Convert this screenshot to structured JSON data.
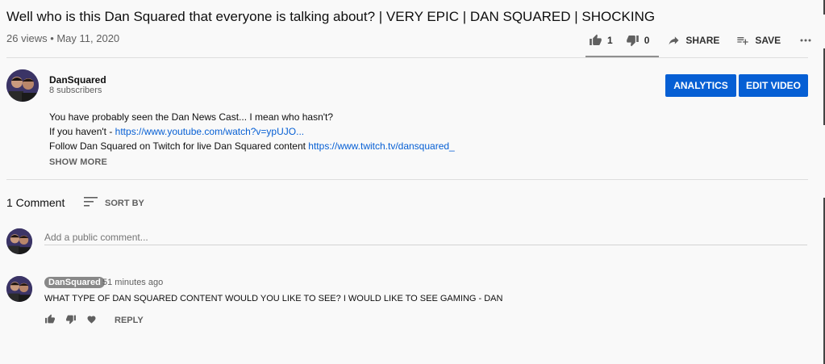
{
  "video": {
    "title": "Well who is this Dan Squared that everyone is talking about? | VERY EPIC | DAN SQUARED | SHOCKING",
    "meta": "26 views • May 11, 2020"
  },
  "actions": {
    "like_count": "1",
    "dislike_count": "0",
    "share_label": "SHARE",
    "save_label": "SAVE",
    "more_icon": "more-horizontal-icon"
  },
  "channel": {
    "name": "DanSquared",
    "subscribers": "8 subscribers",
    "analytics_label": "ANALYTICS",
    "edit_label": "EDIT VIDEO"
  },
  "description": {
    "line1": "You have probably seen the Dan News Cast... I mean who hasn't?",
    "line2_prefix": "If you haven't - ",
    "line2_link": "https://www.youtube.com/watch?v=ypUJO...",
    "line3_prefix": "Follow Dan Squared on Twitch for live Dan Squared content ",
    "line3_link": "https://www.twitch.tv/dansquared_",
    "show_more": "SHOW MORE"
  },
  "comments": {
    "count_label": "1 Comment",
    "sort_label": "SORT BY",
    "add_placeholder": "Add a public comment...",
    "items": [
      {
        "author": "DanSquared",
        "time": "51 minutes ago",
        "text": "WHAT TYPE OF DAN SQUARED CONTENT WOULD YOU LIKE TO SEE? I WOULD LIKE TO SEE GAMING - DAN",
        "reply_label": "REPLY"
      }
    ]
  },
  "colors": {
    "accent": "#065fd4",
    "background": "#f9f9f9",
    "secondary_text": "#606060"
  }
}
